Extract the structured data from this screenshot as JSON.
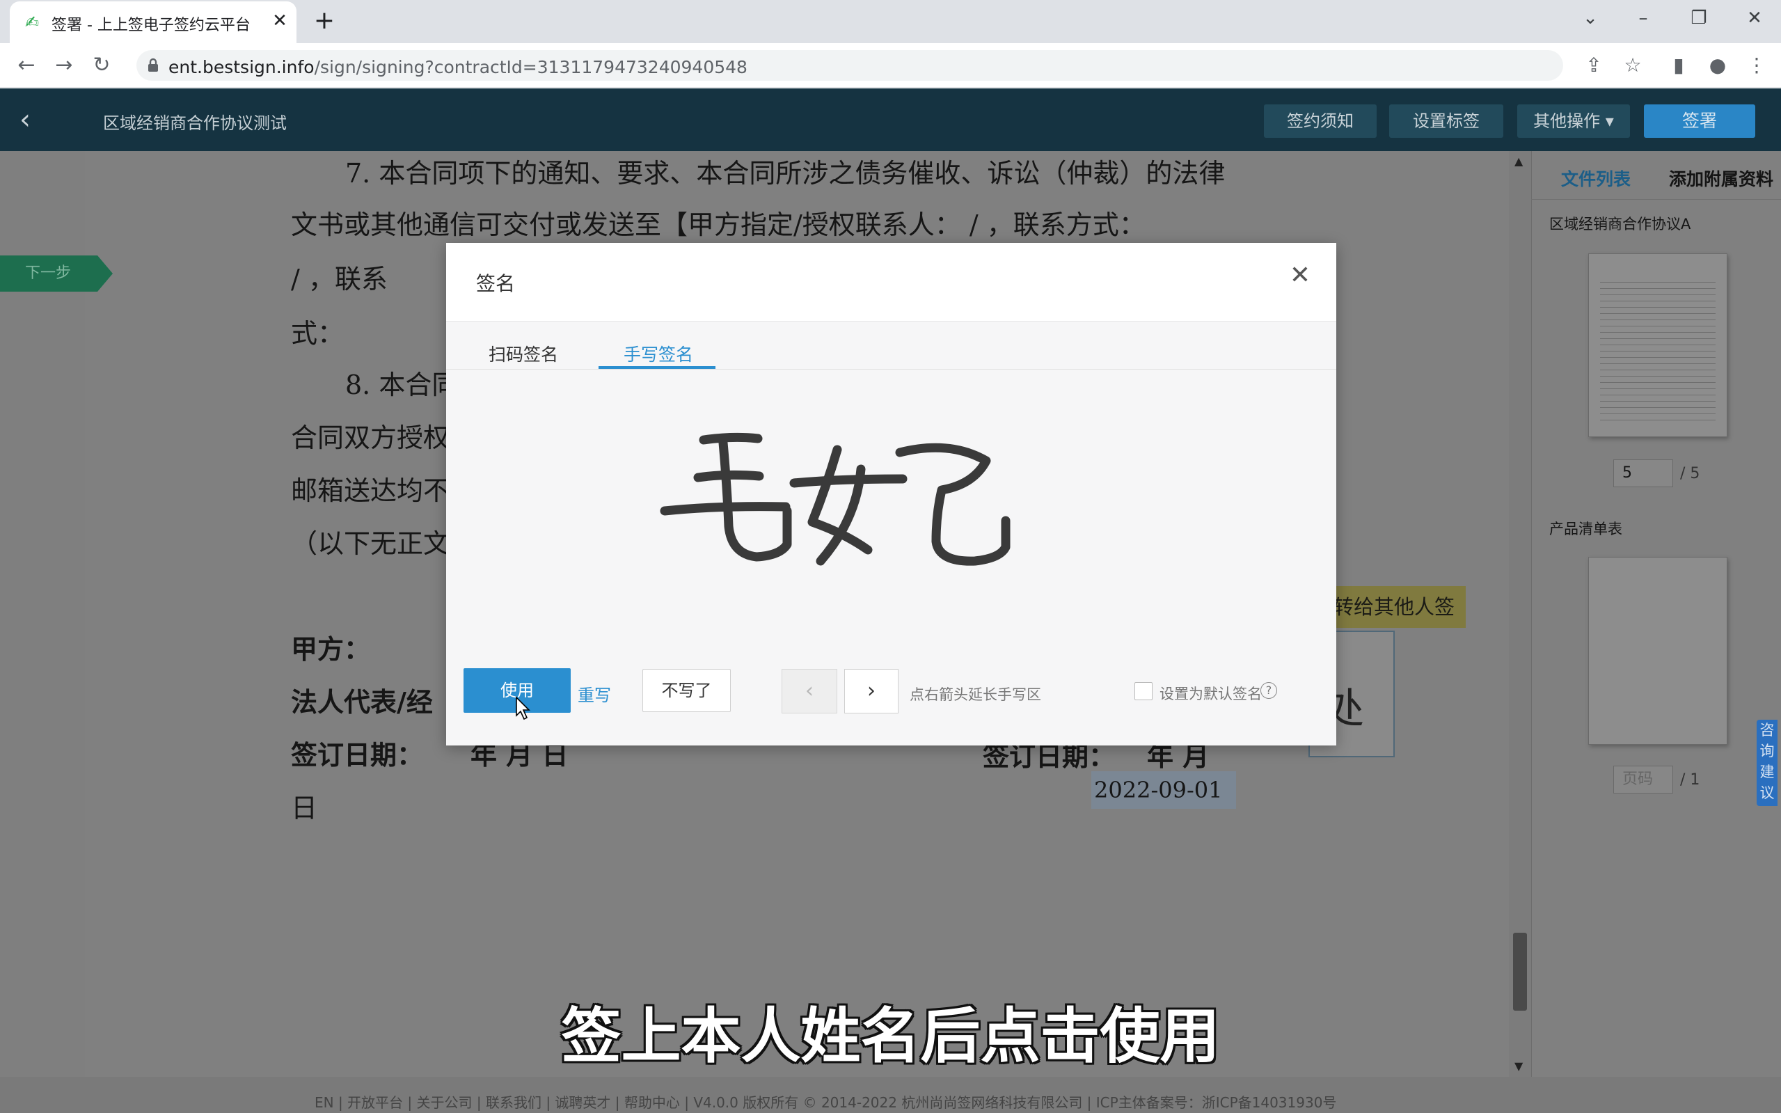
{
  "browser": {
    "tab_title": "签署 - 上上签电子签约云平台",
    "tab_close": "✕",
    "new_tab": "+",
    "url_host": "ent.bestsign.info",
    "url_path": "/sign/signing?contractId=3131179473240940548",
    "icons": [
      "back-icon",
      "forward-icon",
      "reload-icon",
      "lock-icon",
      "share-icon",
      "star-icon",
      "sidepanel-icon",
      "profile-icon",
      "menu-icon"
    ]
  },
  "header": {
    "back": "‹",
    "title": "区域经销商合作协议测试",
    "buttons": [
      "签约须知",
      "设置标签",
      "其他操作"
    ],
    "sign_button": "签署"
  },
  "document": {
    "lines": [
      "7. 本合同项下的通知、要求、本合同所涉之债务催收、诉讼（仲裁）的法律",
      "文书或其他通信可交付或发送至【甲方指定/授权联系人：   /    ，联系方式：",
      "/      ，联系",
      "式：",
      "8. 本合同",
      "合同双方授权",
      "邮箱送达均不",
      "（以下无正文"
    ],
    "party_a": "甲方：",
    "legal_rep": "法人代表/经",
    "sign_date_left": "签订日期：",
    "date_placeholder_left": "年    月    日",
    "sign_date_right": "签订日期：",
    "date_placeholder_right": "年    月",
    "trailing_day": "日",
    "date_value": "2022-09-01",
    "next_step": "下一步",
    "transfer": "转给其他人签",
    "sig_glyph": "处"
  },
  "sidebar": {
    "tabs": [
      "文件列表",
      "添加附属资料"
    ],
    "doc1_name": "区域经销商合作协议A",
    "doc1_page": "5",
    "doc1_total": "/ 5",
    "doc2_name": "产品清单表",
    "doc2_page": "页码",
    "doc2_total": "/ 1",
    "consult": "咨询建议"
  },
  "modal": {
    "title": "签名",
    "close": "✕",
    "tabs": [
      "扫码签名",
      "手写签名"
    ],
    "active_tab": "手写签名",
    "use_button": "使用",
    "rewrite": "重写",
    "cancel_button": "不写了",
    "prev": "‹",
    "next": "›",
    "hint": "点右箭头延长手写区",
    "default_label": "设置为默认签名",
    "help": "?",
    "default_checked": false
  },
  "footer": {
    "text": "EN  |  开放平台  |  关于公司  |  联系我们  |  诚聘英才  |  帮助中心  |  V4.0.0 版权所有 © 2014-2022 杭州尚尚签网络科技有限公司  |  ICP主体备案号：浙ICP备14031930号"
  },
  "subtitle": "签上本人姓名后点击使用",
  "colors": {
    "header_bg": "#153341",
    "accent_blue": "#2b8fd0",
    "next_step_green": "#1d6e4e",
    "overlay_gray": "#7f7f7f"
  }
}
